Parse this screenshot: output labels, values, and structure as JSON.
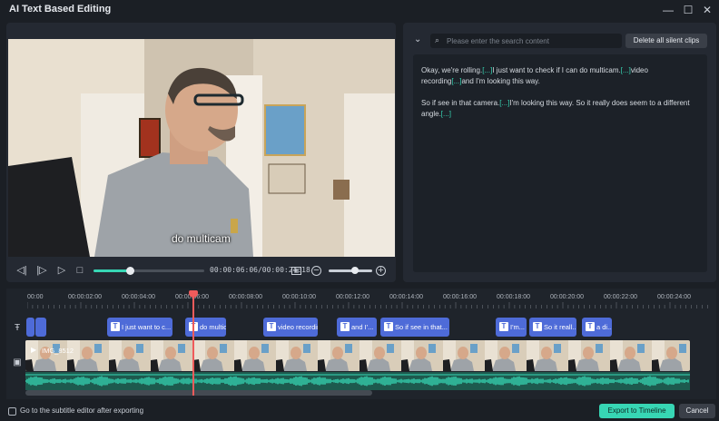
{
  "window": {
    "title": "AI Text Based Editing",
    "minimize_glyph": "—",
    "maximize_glyph": "☐",
    "close_glyph": "✕"
  },
  "preview": {
    "subtitle_overlay": "do multicam",
    "timecode": "00:00:06:06/00:00:24:18",
    "progress": 0.33,
    "zoom_level": 0.6
  },
  "text_panel": {
    "search_placeholder": "Please enter the search content",
    "delete_button": "Delete all silent clips",
    "paragraphs": [
      [
        {
          "text": "Okay, we're rolling."
        },
        {
          "text": "[...]",
          "silent": true
        },
        {
          "text": "I just want to check if I can do multicam."
        },
        {
          "text": "[...]",
          "silent": true
        },
        {
          "text": "video recording"
        },
        {
          "text": "[...]",
          "silent": true
        },
        {
          "text": "and I'm looking this way."
        }
      ],
      [
        {
          "text": " So if  see  in that camera."
        },
        {
          "text": "[...]",
          "silent": true
        },
        {
          "text": "I'm  looking this way. So it really does seem to  a different angle."
        },
        {
          "text": "[...]",
          "silent": true
        }
      ]
    ]
  },
  "timeline": {
    "ruler_labels": [
      "00:00",
      "00:00:02:00",
      "00:00:04:00",
      "00:00:06:00",
      "00:00:08:00",
      "00:00:10:00",
      "00:00:12:00",
      "00:00:14:00",
      "00:00:16:00",
      "00:00:18:00",
      "00:00:20:00",
      "00:00:22:00",
      "00:00:24:00"
    ],
    "subtitle_clips": [
      "",
      "",
      "I just want to c...",
      "do multicam",
      "video recording",
      "and I'...",
      "So if  see  in that...",
      "I'm...",
      "So it reall...",
      "a di..."
    ],
    "video_clip_name": "IMG_8512",
    "playhead_time_seconds": 6.2,
    "colors": {
      "accent": "#37d6b4",
      "subtitle_clip": "#4e6bd8",
      "playhead": "#ef5b5b",
      "audio": "#1d5a4e"
    }
  },
  "footer": {
    "checkbox_label": "Go to the subtitle editor after exporting",
    "checkbox_checked": false,
    "export_button": "Export to Timeline",
    "cancel_button": "Cancel"
  }
}
